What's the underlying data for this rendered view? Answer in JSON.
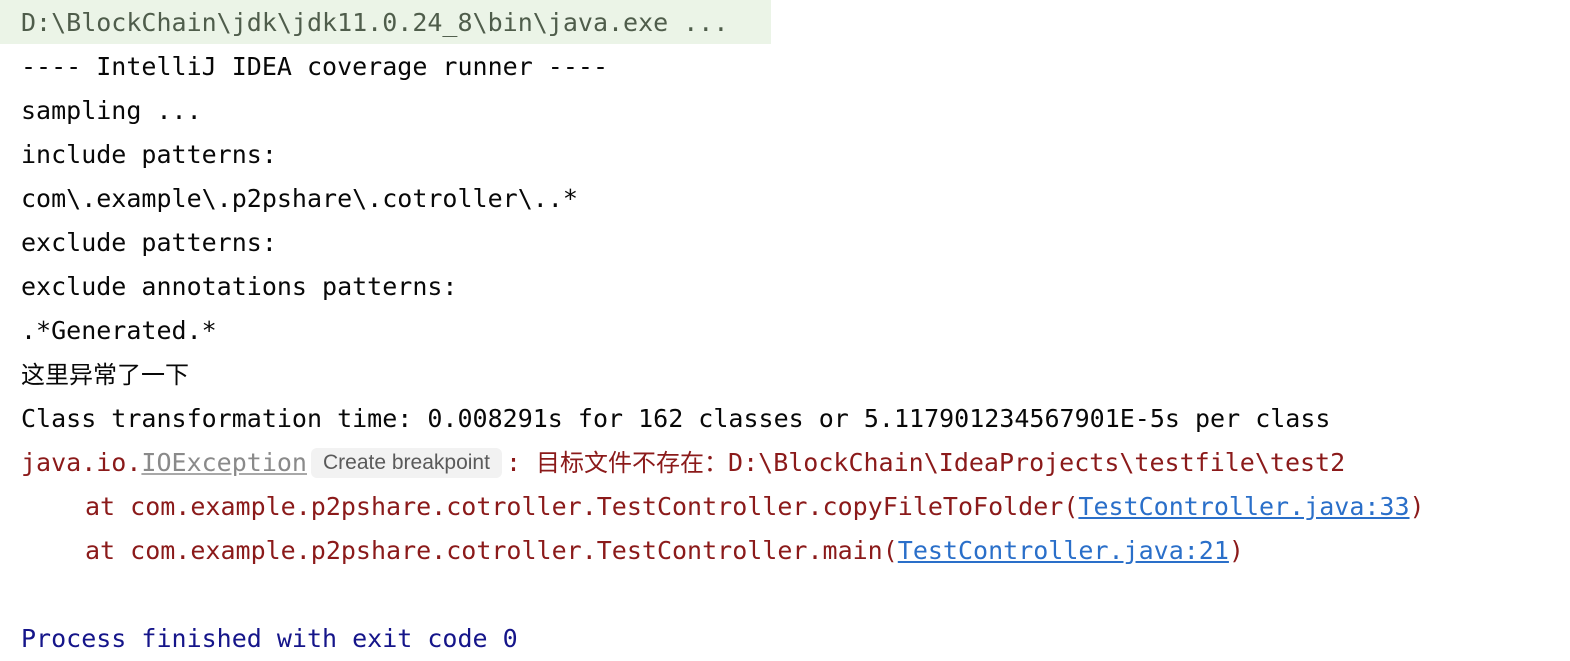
{
  "console": {
    "command_line": "D:\\BlockChain\\jdk\\jdk11.0.24_8\\bin\\java.exe ...",
    "output_lines": [
      "---- IntelliJ IDEA coverage runner ----",
      "sampling ...",
      "include patterns:",
      "com\\.example\\.p2pshare\\.cotroller\\..*",
      "exclude patterns:",
      "exclude annotations patterns:",
      ".*Generated.*"
    ],
    "cn_message": "这里异常了一下",
    "transform_line": "Class transformation time: 0.008291s for 162 classes or 5.117901234567901E-5s per class",
    "exception": {
      "prefix": "java.io.",
      "class_link": "IOException",
      "breakpoint_label": "Create breakpoint",
      "separator": ": ",
      "message_cn": "目标文件不存在：",
      "message_path": "D:\\BlockChain\\IdeaProjects\\testfile\\test2"
    },
    "stack_trace": [
      {
        "text": "at com.example.p2pshare.cotroller.TestController.copyFileToFolder(",
        "link": "TestController.java:33",
        "suffix": ")"
      },
      {
        "text": "at com.example.p2pshare.cotroller.TestController.main(",
        "link": "TestController.java:21",
        "suffix": ")"
      }
    ],
    "exit_line": "Process finished with exit code 0"
  },
  "colors": {
    "background": "#ffffff",
    "command_highlight": "#ebf4e7",
    "error_text": "#8b1a1a",
    "hyperlink": "#2a6fc9",
    "exit_text": "#15158a"
  }
}
